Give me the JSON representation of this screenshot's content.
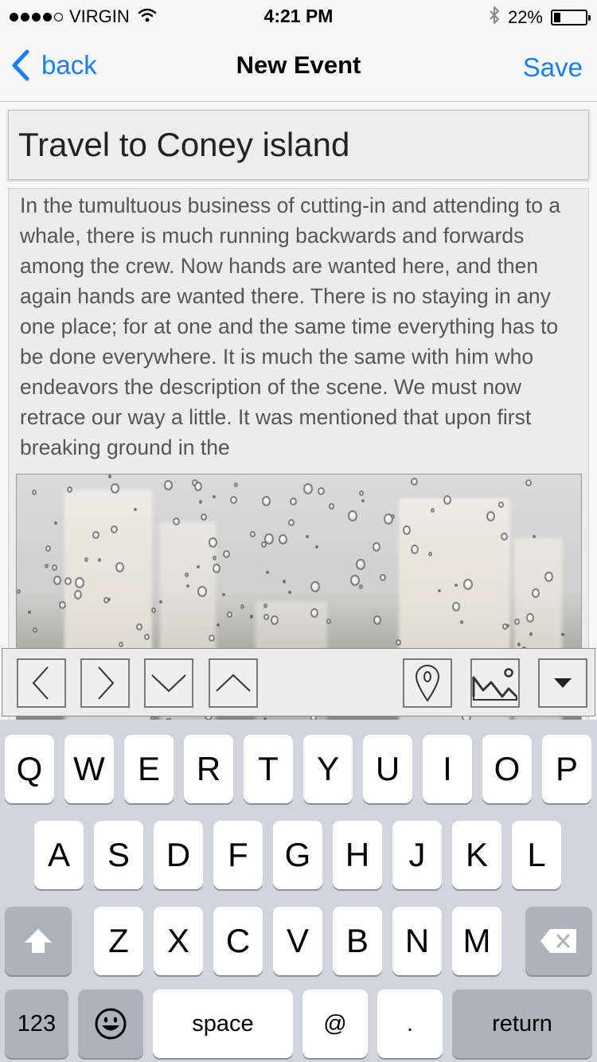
{
  "status_bar": {
    "carrier": "VIRGIN",
    "time": "4:21 PM",
    "battery_text": "22%",
    "battery_level": 0.22,
    "signal_bars_filled": 4,
    "signal_bars_total": 5
  },
  "nav": {
    "back_label": "back",
    "title": "New Event",
    "save_label": "Save",
    "accent_color": "#1a7ef5"
  },
  "event": {
    "title": "Travel to Coney island",
    "body": "In the tumultuous business of cutting-in and attending to a whale, there is much running backwards and forwards among the crew. Now hands are wanted here, and then again hands are wanted there. There is no staying in any one place; for at one and the same time everything has to be done everywhere. It is much the same with him who endeavors the description of the scene. We must now retrace our way a little. It was mentioned that upon first breaking ground in the"
  },
  "toolbar": {
    "buttons": [
      {
        "icon": "chevron-left-icon"
      },
      {
        "icon": "chevron-right-icon"
      },
      {
        "icon": "chevron-down-icon"
      },
      {
        "icon": "chevron-up-icon"
      },
      {
        "icon": "location-pin-icon"
      },
      {
        "icon": "image-icon"
      },
      {
        "icon": "caret-down-icon"
      }
    ]
  },
  "keyboard": {
    "row1": [
      "Q",
      "W",
      "E",
      "R",
      "T",
      "Y",
      "U",
      "I",
      "O",
      "P"
    ],
    "row2": [
      "A",
      "S",
      "D",
      "F",
      "G",
      "H",
      "J",
      "K",
      "L"
    ],
    "row3": [
      "Z",
      "X",
      "C",
      "V",
      "B",
      "N",
      "M"
    ],
    "numbers_label": "123",
    "space_label": "space",
    "at_label": "@",
    "period_label": ".",
    "return_label": "return"
  }
}
